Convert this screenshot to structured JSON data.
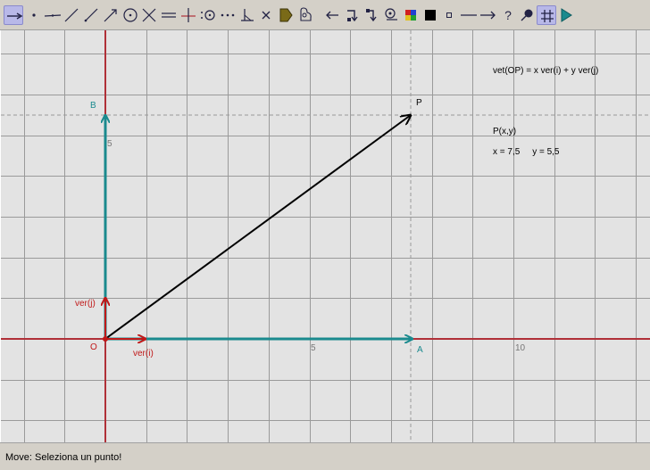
{
  "toolbar": {
    "tools": [
      "vector-tool",
      "point-tool",
      "line-tool",
      "segment-tool",
      "ray-tool",
      "vector-segment-tool",
      "circle-tool",
      "intersection-tool",
      "parallel-tool",
      "perpendicular-tool",
      "midpoint-tool",
      "dotted-line-tool",
      "angle-tool",
      "delete-tool",
      "polygon-fill-tool",
      "locus-tool",
      "undo-tool",
      "move-tool",
      "redo-tool",
      "magnifier-tool",
      "color-tool",
      "fill-tool",
      "small-point-tool",
      "line-style-tool",
      "arrow-style-tool",
      "help-tool",
      "pointer-tool",
      "grid-tool",
      "play-tool"
    ]
  },
  "canvas": {
    "labels": {
      "B": "B",
      "P": "P",
      "O": "O",
      "A": "A",
      "ver_j": "ver(j)",
      "ver_i": "ver(i)",
      "y_tick_5": "5",
      "x_tick_5": "5",
      "x_tick_10": "10"
    },
    "formula": "vet(OP) = x ver(i) + y ver(j)",
    "point_title": "P(x,y)",
    "coords": "x = 7,5     y = 5,5"
  },
  "colors": {
    "axis": "#b03038",
    "teal": "#1a8a8e",
    "red_vec": "#c01818",
    "black_vec": "#000000",
    "grid": "#9a9a9a"
  },
  "status": {
    "text": "Move: Seleziona un punto!"
  }
}
